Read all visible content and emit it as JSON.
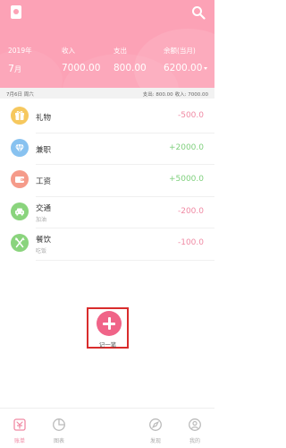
{
  "header": {
    "year": "2019年",
    "month_number": "7",
    "month_unit": "月",
    "income_label": "收入",
    "income_value": "7000.00",
    "expense_label": "支出",
    "expense_value": "800.00",
    "balance_label": "余额(当月)",
    "balance_value": "6200.00",
    "icons": {
      "left": "notepad-icon",
      "right": "search-icon"
    }
  },
  "day_summary": {
    "date": "7月6日 周六",
    "expense_text": "支出: 800.00",
    "income_text": "收入: 7000.00"
  },
  "records": [
    {
      "title": "礼物",
      "subtitle": "",
      "amount": "-500.0",
      "type": "expense",
      "icon": "gift-icon",
      "color": "#f6c85e"
    },
    {
      "title": "兼职",
      "subtitle": "",
      "amount": "+2000.0",
      "type": "income",
      "icon": "diamond-icon",
      "color": "#88c2f0"
    },
    {
      "title": "工资",
      "subtitle": "",
      "amount": "+5000.0",
      "type": "income",
      "icon": "wallet-icon",
      "color": "#f59b8a"
    },
    {
      "title": "交通",
      "subtitle": "加油",
      "amount": "-200.0",
      "type": "expense",
      "icon": "car-icon",
      "color": "#8ad47d"
    },
    {
      "title": "餐饮",
      "subtitle": "吃饭",
      "amount": "-100.0",
      "type": "expense",
      "icon": "utensils-icon",
      "color": "#8ad47d"
    }
  ],
  "add_button": {
    "label": "记一笔",
    "icon": "plus-icon",
    "color": "#f06488"
  },
  "nav": [
    {
      "label": "账单",
      "icon": "bill-icon",
      "active": true
    },
    {
      "label": "图表",
      "icon": "chart-icon",
      "active": false
    },
    {
      "label": "发现",
      "icon": "discover-icon",
      "active": false
    },
    {
      "label": "我的",
      "icon": "user-icon",
      "active": false
    }
  ],
  "colors": {
    "header": "#fca2b6",
    "expense": "#f08aa4",
    "income": "#7fd07d",
    "highlight": "#d92c2c"
  }
}
